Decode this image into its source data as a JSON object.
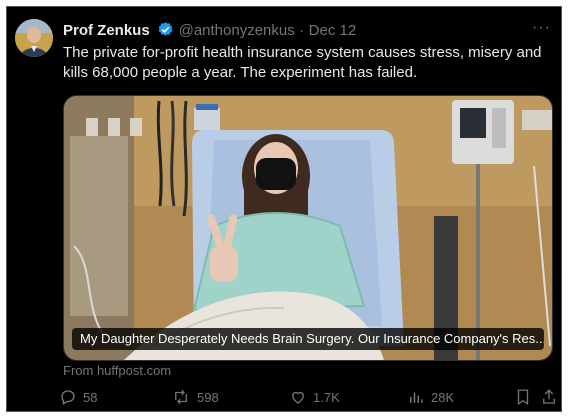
{
  "author": {
    "name": "Prof Zenkus",
    "handle": "@anthonyzenkus",
    "date": "Dec 12",
    "separator": "·",
    "verified": true
  },
  "more_label": "···",
  "tweet": {
    "text": "The private for-profit health insurance system causes stress, misery and kills 68,000 people a year. The experiment has failed."
  },
  "link_card": {
    "headline": "My Daughter Desperately Needs Brain Surgery. Our Insurance Company's Res...",
    "source": "From huffpost.com"
  },
  "actions": {
    "replies": "58",
    "reposts": "598",
    "likes": "1.7K",
    "views": "28K"
  },
  "colors": {
    "background": "#000000",
    "text": "#e7e9ea",
    "muted": "#71767b",
    "verified": "#1d9bf0"
  },
  "icons": [
    "verified-badge-icon",
    "more-icon",
    "reply-icon",
    "repost-icon",
    "like-icon",
    "views-icon",
    "bookmark-icon",
    "share-icon"
  ]
}
